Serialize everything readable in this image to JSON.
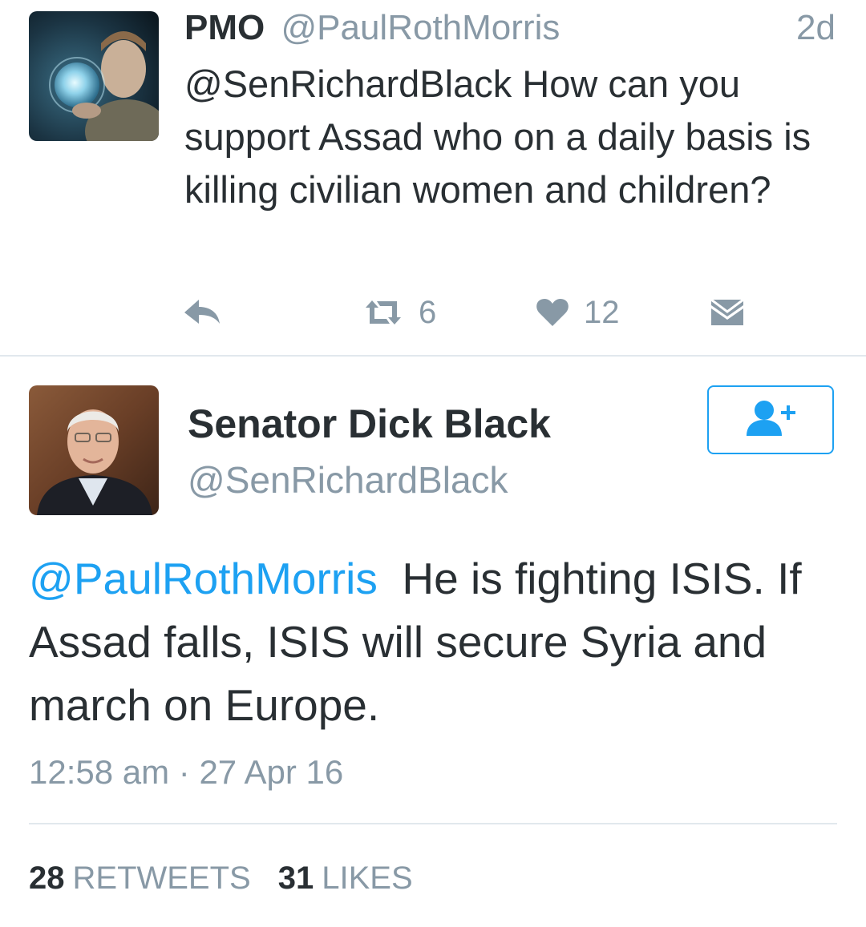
{
  "reply_tweet": {
    "name": "PMO",
    "handle": "@PaulRothMorris",
    "time": "2d",
    "text": "@SenRichardBlack How can you support Assad who on a daily basis is killing civilian women and children?",
    "actions": {
      "reply_icon": "reply-icon",
      "retweet_icon": "retweet-icon",
      "retweet_count": "6",
      "like_icon": "heart-icon",
      "like_count": "12",
      "dm_icon": "envelope-icon"
    }
  },
  "main_tweet": {
    "name": "Senator Dick Black",
    "handle": "@SenRichardBlack",
    "follow_icon": "add-user-icon",
    "mention": "@PaulRothMorris",
    "text": "He is fighting ISIS. If Assad falls, ISIS will secure Syria and march on Europe.",
    "timestamp": "12:58 am · 27 Apr 16",
    "retweets_count": "28",
    "retweets_label": "RETWEETS",
    "likes_count": "31",
    "likes_label": "LIKES"
  },
  "colors": {
    "accent": "#1da1f2",
    "secondary_text": "#8899a6",
    "primary_text": "#292f33",
    "divider": "#e1e8ed"
  }
}
